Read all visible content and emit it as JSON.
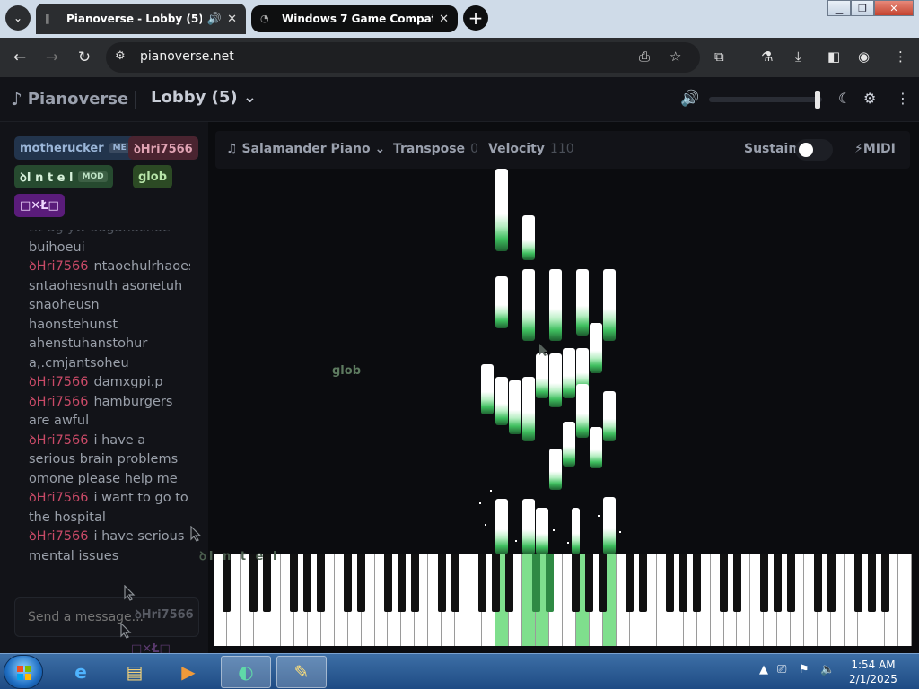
{
  "browser": {
    "tabs": [
      {
        "title": "Pianoverse - Lobby (5)",
        "active": true
      },
      {
        "title": "Windows 7 Game Compatibili",
        "active": false
      }
    ],
    "url": "pianoverse.net"
  },
  "app": {
    "logo_text": "Pianoverse",
    "room_title": "Lobby (5)",
    "volume_fraction": 0.98
  },
  "users": [
    {
      "name": "motherucker",
      "badge": "ME",
      "color": "#9bb6d8",
      "bg": "#22344c"
    },
    {
      "name": "ꝺHri7566",
      "badge": "",
      "color": "#e0a3b3",
      "bg": "#4a2430"
    },
    {
      "name": "ꝺI n t e l",
      "badge": "MOD",
      "color": "#d6f0da",
      "bg": "#264a2f"
    },
    {
      "name": "glob",
      "badge": "",
      "color": "#b8e6a9",
      "bg": "#2c4a24"
    },
    {
      "name": "□✕Ł□",
      "badge": "",
      "color": "#f0d8ff",
      "bg": "#5a1c7a"
    }
  ],
  "chat": {
    "faded_line": "t.t ag yw ouganucnoe",
    "messages": [
      {
        "author": "",
        "text": "buihoeui"
      },
      {
        "author": "ꝺHri7566",
        "text": "ntaoehulrhaoesntuh sntaohesnuth asonetuh snaoheusn haonstehunst ahenstuhanstohur a,.cmjantsoheu"
      },
      {
        "author": "ꝺHri7566",
        "text": "damxgpi.p"
      },
      {
        "author": "ꝺHri7566",
        "text": "hamburgers are awful"
      },
      {
        "author": "ꝺHri7566",
        "text": "i have a serious brain problems omone please help me"
      },
      {
        "author": "ꝺHri7566",
        "text": "i want to go to the hospital"
      },
      {
        "author": "ꝺHri7566",
        "text": "i have serious mental issues"
      }
    ],
    "input_placeholder": "Send a message..."
  },
  "controls": {
    "instrument": "Salamander Piano",
    "transpose_label": "Transpose",
    "transpose_value": "0",
    "velocity_label": "Velocity",
    "velocity_value": "110",
    "sustain_label": "Sustain",
    "sustain_on": false,
    "midi_label": "MIDI"
  },
  "cursors": [
    {
      "name": "glob"
    },
    {
      "name": "ꝺI n t e l"
    },
    {
      "name": "ꝺHri7566"
    },
    {
      "name": "□✕Ł□"
    }
  ],
  "taskbar": {
    "time": "1:54 AM",
    "date": "2/1/2025"
  },
  "colors": {
    "accent_green": "#3fbf5f",
    "author_pink": "#c94a67"
  }
}
